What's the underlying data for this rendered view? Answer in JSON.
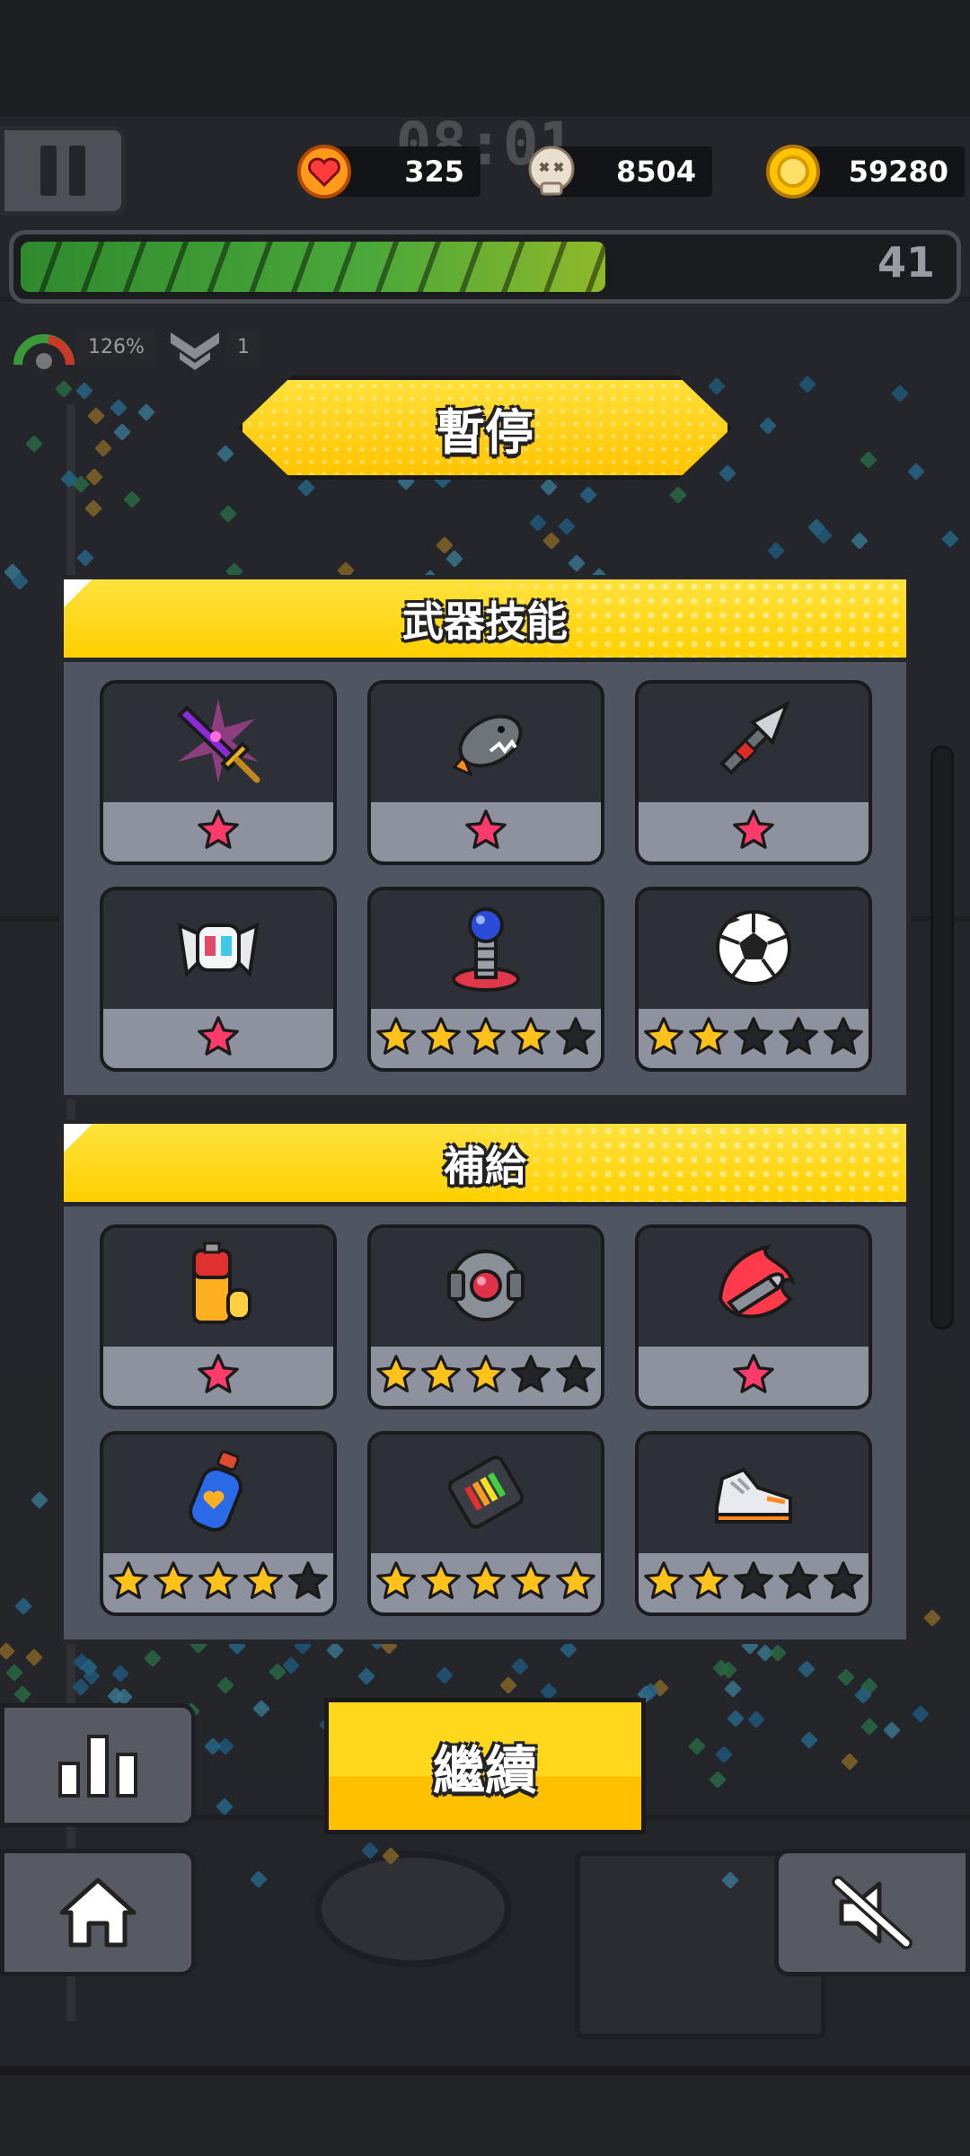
{
  "hud": {
    "timer": "08:01",
    "hearts": "325",
    "kills": "8504",
    "coins": "59280",
    "level": "41",
    "xp_progress": 0.62,
    "speed_buff": "126%",
    "rank_buff": "1"
  },
  "pause": {
    "title": "暫停",
    "continue_label": "繼續"
  },
  "weapons": {
    "title": "武器技能",
    "items": [
      {
        "icon": "purple-sword-icon",
        "stars": 1,
        "max_stars": 1
      },
      {
        "icon": "shark-rocket-icon",
        "stars": 1,
        "max_stars": 1
      },
      {
        "icon": "kunai-icon",
        "stars": 1,
        "max_stars": 1
      },
      {
        "icon": "drone-helmet-icon",
        "stars": 1,
        "max_stars": 1
      },
      {
        "icon": "tesla-coil-icon",
        "stars": 4,
        "max_stars": 5
      },
      {
        "icon": "soccer-ball-icon",
        "stars": 2,
        "max_stars": 5
      }
    ]
  },
  "supplies": {
    "title": "補給",
    "items": [
      {
        "icon": "battery-icon",
        "stars": 1,
        "max_stars": 1
      },
      {
        "icon": "energy-cube-icon",
        "stars": 3,
        "max_stars": 5
      },
      {
        "icon": "fire-bullet-icon",
        "stars": 1,
        "max_stars": 1
      },
      {
        "icon": "heart-potion-icon",
        "stars": 4,
        "max_stars": 5
      },
      {
        "icon": "ammo-clip-icon",
        "stars": 5,
        "max_stars": 5
      },
      {
        "icon": "sneaker-icon",
        "stars": 2,
        "max_stars": 5
      }
    ]
  },
  "colors": {
    "accent_yellow": "#ffd000",
    "star_gold": "#ffc21a",
    "star_pink": "#ff3b6b",
    "star_empty": "#23252b",
    "panel_bg": "#505562"
  }
}
